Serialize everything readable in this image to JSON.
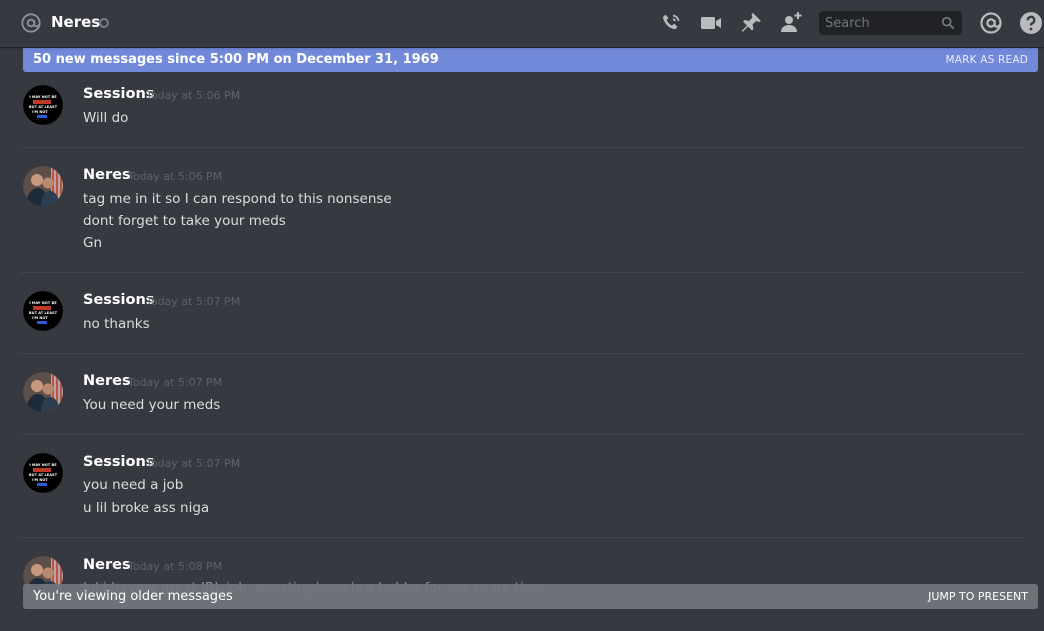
{
  "header": {
    "user_name": "Neres",
    "search_placeholder": "Search"
  },
  "new_messages_bar": {
    "text": "50 new messages since 5:00 PM on December 31, 1969",
    "action": "MARK AS READ"
  },
  "messages": [
    {
      "author": "Sessions",
      "timestamp": "Today at 5:06 PM",
      "lines": [
        "Will do"
      ]
    },
    {
      "author": "Neres",
      "timestamp": "Today at 5:06 PM",
      "lines": [
        "tag me in it so I can respond to this nonsense",
        "dont forget to take your meds",
        "Gn"
      ]
    },
    {
      "author": "Sessions",
      "timestamp": "Today at 5:07 PM",
      "lines": [
        "no thanks"
      ]
    },
    {
      "author": "Neres",
      "timestamp": "Today at 5:07 PM",
      "lines": [
        "You need your meds"
      ]
    },
    {
      "author": "Sessions",
      "timestamp": "Today at 5:07 PM",
      "lines": [
        "you need a job",
        "u lil broke ass niga"
      ]
    },
    {
      "author": "Neres",
      "timestamp": "Today at 5:08 PM",
      "lines": [
        "lol i have a great IRL job, questing/osrs is a hobby for my spare time"
      ]
    }
  ],
  "older_bar": {
    "text": "You're viewing older messages",
    "action": "JUMP TO PRESENT"
  },
  "avatar_text": {
    "line1": "I MAY NOT BE",
    "line2": "BUT AT LEAST",
    "line3": "I'M NOT"
  },
  "colors": {
    "background": "#36393f",
    "accent_bar": "#7289da",
    "older_bar": "#72767d"
  }
}
